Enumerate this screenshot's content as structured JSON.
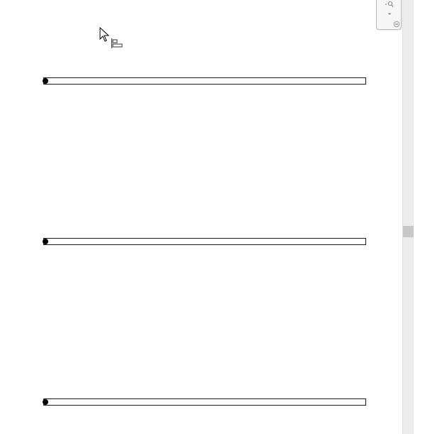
{
  "canvas": {
    "lanes": [
      {
        "label": ""
      },
      {
        "label": ""
      },
      {
        "label": ""
      }
    ]
  },
  "toolbar": {
    "items": [
      {
        "icon": "search-zoom-icon"
      },
      {
        "icon": "chevron-down-icon"
      },
      {
        "icon": "collapse-circle-icon"
      }
    ]
  },
  "cursor": {
    "icon": "pointer-arrow-icon",
    "tool_icon": "align-left-icon"
  },
  "colors": {
    "line": "#1a1a1a",
    "scroll_track": "#ececec",
    "scroll_thumb": "#c8c8c8"
  }
}
